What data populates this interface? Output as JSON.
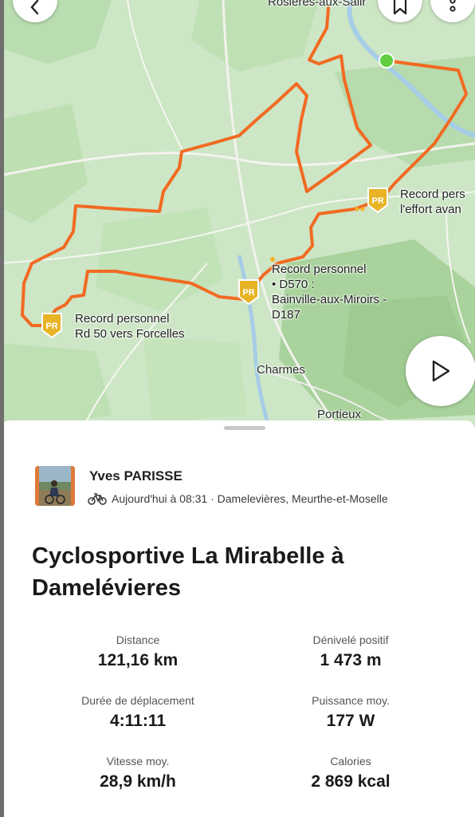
{
  "map": {
    "towns": {
      "rosieres": "Rosières-aux-Salir",
      "charmes": "Charmes",
      "portieux": "Portieux"
    },
    "pr_badge_text": "PR",
    "records": [
      {
        "lines": [
          "Record pers",
          "l'effort avan"
        ]
      },
      {
        "lines": [
          "Record personnel",
          "• D570 :",
          "Bainville-aux-Miroirs -",
          "D187"
        ]
      },
      {
        "lines": [
          "Record personnel",
          "Rd 50 vers Forcelles"
        ]
      }
    ],
    "colors": {
      "route": "#f26a22",
      "start": "#5fce3f",
      "badge": "#e8b325"
    },
    "buttons": {
      "back": "chevron-left-icon",
      "bookmark": "bookmark-icon",
      "more": "more-vertical-icon",
      "play": "play-icon"
    }
  },
  "activity": {
    "user": "Yves PARISSE",
    "meta": "Aujourd'hui à 08:31 · Damelevières, Meurthe-et-Moselle",
    "title": "Cyclosportive La Mirabelle à Damelévieres",
    "stats": [
      {
        "label": "Distance",
        "value": "121,16 km"
      },
      {
        "label": "Dénivelé positif",
        "value": "1 473 m"
      },
      {
        "label": "Durée de déplacement",
        "value": "4:11:11"
      },
      {
        "label": "Puissance moy.",
        "value": "177 W"
      },
      {
        "label": "Vitesse moy.",
        "value": "28,9 km/h"
      },
      {
        "label": "Calories",
        "value": "2 869 kcal"
      }
    ]
  }
}
